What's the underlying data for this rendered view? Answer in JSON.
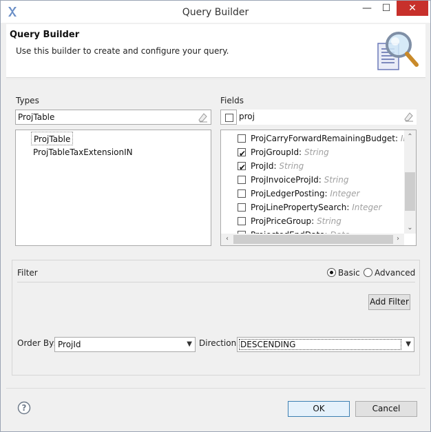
{
  "window": {
    "title": "Query Builder",
    "minimize": "—",
    "maximize": "☐",
    "close": "✕"
  },
  "banner": {
    "title": "Query Builder",
    "description": "Use this builder to create and configure your query."
  },
  "types": {
    "label": "Types",
    "search_value": "ProjTable",
    "items": [
      {
        "label": "ProjTable",
        "selected": true
      },
      {
        "label": "ProjTableTaxExtensionIN",
        "selected": false
      }
    ]
  },
  "fields": {
    "label": "Fields",
    "select_all_checked": false,
    "search_value": "proj",
    "items": [
      {
        "name": "ProjCarryForwardRemainingBudget:",
        "type": "Integer",
        "checked": false
      },
      {
        "name": "ProjGroupId:",
        "type": "String",
        "checked": true
      },
      {
        "name": "ProjId:",
        "type": "String",
        "checked": true
      },
      {
        "name": "ProjInvoiceProjId:",
        "type": "String",
        "checked": false
      },
      {
        "name": "ProjLedgerPosting:",
        "type": "Integer",
        "checked": false
      },
      {
        "name": "ProjLinePropertySearch:",
        "type": "Integer",
        "checked": false
      },
      {
        "name": "ProjPriceGroup:",
        "type": "String",
        "checked": false
      },
      {
        "name": "ProjectedEndDate:",
        "type": "Date",
        "checked": false
      }
    ],
    "scroll": {
      "vertical_position": 0.55,
      "horizontal_position": 0.0
    }
  },
  "filter": {
    "label": "Filter",
    "mode_options": [
      "Basic",
      "Advanced"
    ],
    "selected_mode": "Basic",
    "add_filter_label": "Add Filter",
    "order_by_label": "Order By:",
    "order_by_value": "ProjId",
    "direction_label": "Direction:",
    "direction_value": "DESCENDING"
  },
  "footer": {
    "help_glyph": "?",
    "ok_label": "OK",
    "cancel_label": "Cancel"
  },
  "colors": {
    "accent": "#3c7fb1",
    "close_button": "#c7302b",
    "type_hint": "#a0a0a0"
  }
}
